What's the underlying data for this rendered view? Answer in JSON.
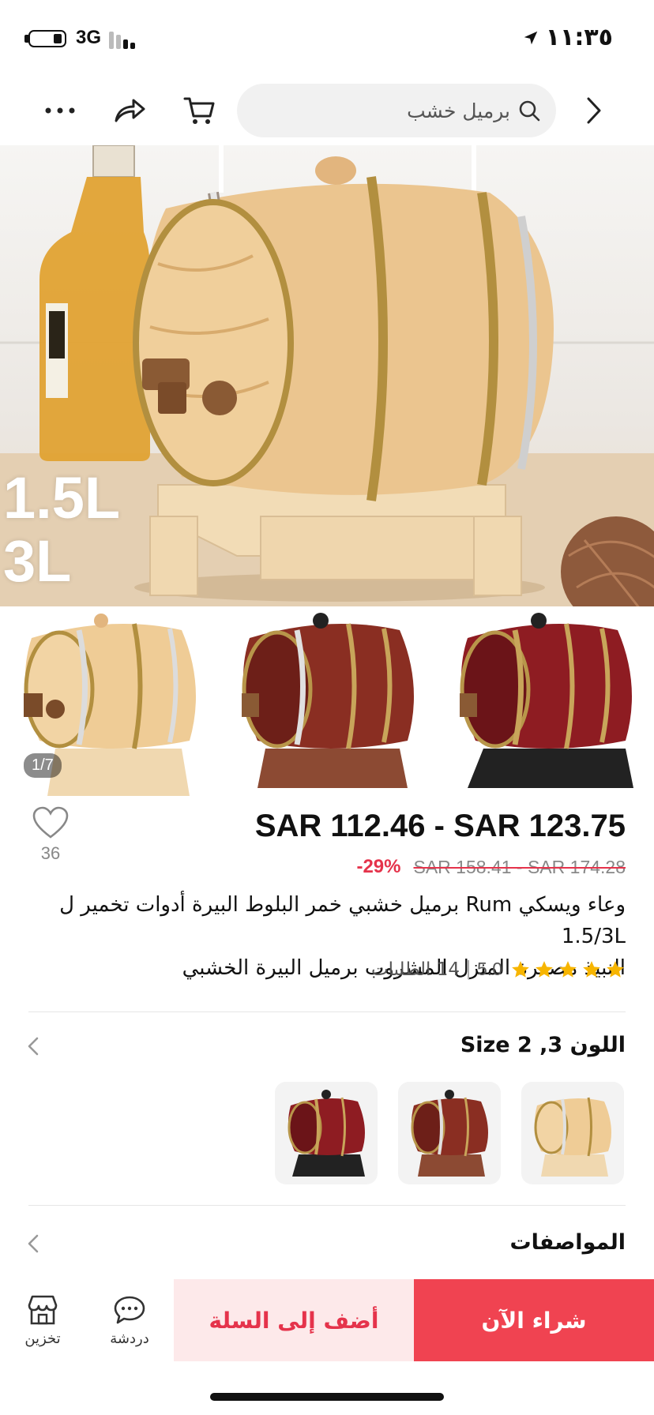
{
  "status_bar": {
    "network": "3G",
    "time": "١١:٣٥"
  },
  "search": {
    "query": "برميل خشب"
  },
  "hero": {
    "overlay_line1": "1.5L",
    "overlay_line2": "3L"
  },
  "gallery": {
    "counter": "1/7"
  },
  "product": {
    "favorites_count": "36",
    "price_range": "SAR 112.46 - SAR 123.75",
    "discount": "-29%",
    "original_price": "SAR 158.41 - SAR 174.28",
    "title_line1": "وعاء ويسكي Rum برميل خشبي خمر البلوط البيرة أدوات تخمير ل 1.5/3L",
    "title_line2": "النبيذ مصغرة المنزل المشروب برميل البيرة الخشبي",
    "rating": "5.0",
    "rating_stars": 5,
    "orders": "14 الطلبات"
  },
  "variants": {
    "label": "اللون 3, Size 2"
  },
  "specs": {
    "label": "المواصفات"
  },
  "bottom_bar": {
    "store_label": "تخزين",
    "chat_label": "دردشة",
    "add_to_cart": "أضف إلى السلة",
    "buy_now": "شراء الآن"
  },
  "colors": {
    "accent": "#f04351",
    "accent_light": "#fde9ea",
    "discount_red": "#e5334b",
    "star": "#f7b500"
  }
}
